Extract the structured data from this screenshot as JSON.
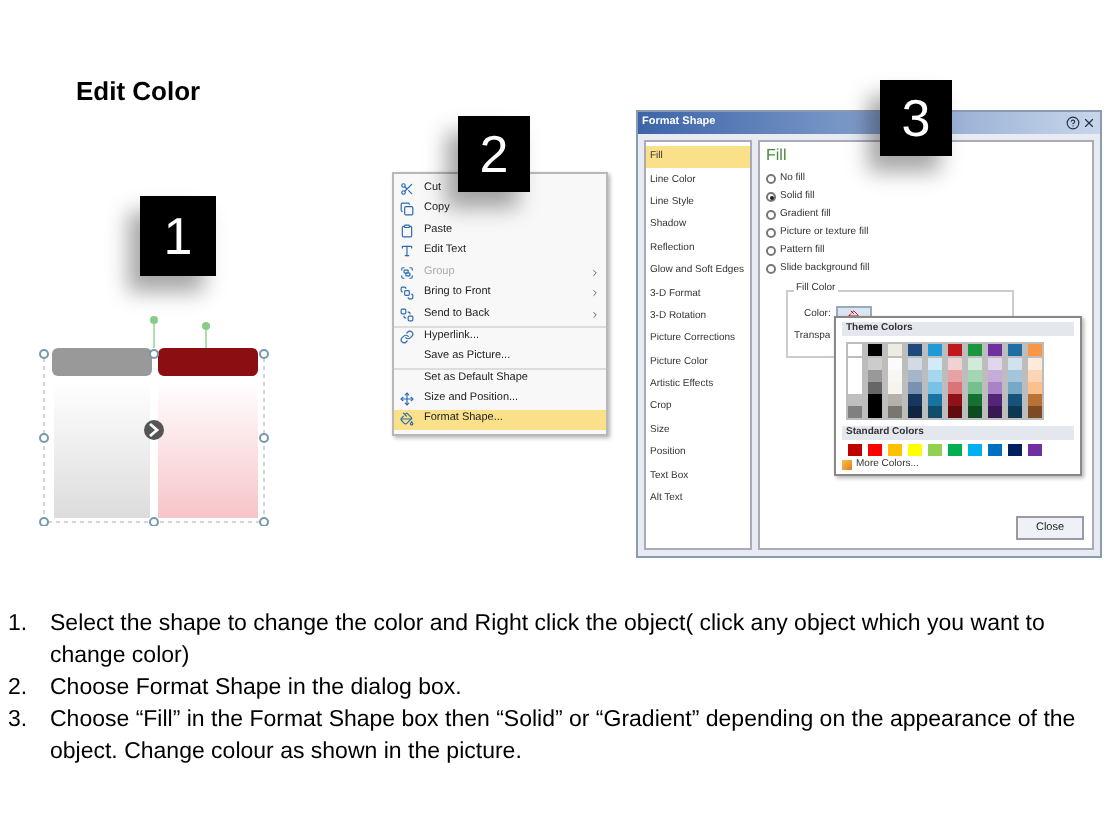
{
  "title": "Edit Color",
  "step_badges": [
    {
      "number": "1"
    },
    {
      "number": "2"
    },
    {
      "number": "3"
    }
  ],
  "context_menu": {
    "items": [
      {
        "label": "Cut",
        "disabled": false,
        "submenu": false,
        "selected": false
      },
      {
        "label": "Copy",
        "disabled": false,
        "submenu": false,
        "selected": false
      },
      {
        "label": "Paste",
        "disabled": false,
        "submenu": false,
        "selected": false
      },
      {
        "label": "Edit Text",
        "disabled": false,
        "submenu": false,
        "selected": false
      },
      {
        "label": "Group",
        "disabled": true,
        "submenu": true,
        "selected": false
      },
      {
        "label": "Bring to Front",
        "disabled": false,
        "submenu": true,
        "selected": false
      },
      {
        "label": "Send to Back",
        "disabled": false,
        "submenu": true,
        "selected": false
      },
      {
        "label": "Hyperlink...",
        "disabled": false,
        "submenu": false,
        "selected": false
      },
      {
        "label": "Save as Picture...",
        "disabled": false,
        "submenu": false,
        "selected": false
      },
      {
        "label": "Set as Default Shape",
        "disabled": false,
        "submenu": false,
        "selected": false
      },
      {
        "label": "Size and Position...",
        "disabled": false,
        "submenu": false,
        "selected": false
      },
      {
        "label": "Format Shape...",
        "disabled": false,
        "submenu": false,
        "selected": true
      }
    ]
  },
  "dialog": {
    "title": "Format Shape",
    "sidebar": [
      {
        "label": "Fill",
        "selected": true
      },
      {
        "label": "Line Color",
        "selected": false
      },
      {
        "label": "Line Style",
        "selected": false
      },
      {
        "label": "Shadow",
        "selected": false
      },
      {
        "label": "Reflection",
        "selected": false
      },
      {
        "label": "Glow and Soft Edges",
        "selected": false
      },
      {
        "label": "3-D Format",
        "selected": false
      },
      {
        "label": "3-D Rotation",
        "selected": false
      },
      {
        "label": "Picture Corrections",
        "selected": false
      },
      {
        "label": "Picture Color",
        "selected": false
      },
      {
        "label": "Artistic Effects",
        "selected": false
      },
      {
        "label": "Crop",
        "selected": false
      },
      {
        "label": "Size",
        "selected": false
      },
      {
        "label": "Position",
        "selected": false
      },
      {
        "label": "Text Box",
        "selected": false
      },
      {
        "label": "Alt Text",
        "selected": false
      }
    ],
    "heading": "Fill",
    "fill_options": [
      {
        "label": "No fill",
        "selected": false
      },
      {
        "label": "Solid fill",
        "selected": true
      },
      {
        "label": "Gradient fill",
        "selected": false
      },
      {
        "label": "Picture or texture fill",
        "selected": false
      },
      {
        "label": "Pattern fill",
        "selected": false
      },
      {
        "label": "Slide background fill",
        "selected": false
      }
    ],
    "fill_color_group": "Fill Color",
    "color_label": "Color:",
    "transparency_label": "Transpa",
    "close_button": "Close"
  },
  "color_popup": {
    "theme_heading": "Theme Colors",
    "theme_colors": [
      {
        "color": "#ffffff"
      },
      {
        "color": "#000000"
      },
      {
        "color": "#eeece1"
      },
      {
        "color": "#1f497d"
      },
      {
        "color": "#1e9ad6"
      },
      {
        "color": "#c0171d"
      },
      {
        "color": "#1a9641"
      },
      {
        "color": "#7030a0"
      },
      {
        "color": "#1c6ea4"
      },
      {
        "color": "#f79646"
      }
    ],
    "standard_heading": "Standard Colors",
    "standard_colors": [
      {
        "color": "#c00000"
      },
      {
        "color": "#ff0000"
      },
      {
        "color": "#ffc000"
      },
      {
        "color": "#ffff00"
      },
      {
        "color": "#92d050"
      },
      {
        "color": "#00b050"
      },
      {
        "color": "#00b0f0"
      },
      {
        "color": "#0070c0"
      },
      {
        "color": "#002060"
      },
      {
        "color": "#7030a0"
      }
    ],
    "more_colors": "More Colors..."
  },
  "instructions": [
    {
      "number": "1.",
      "text": "Select the shape to change the color and Right click the object( click any object which you want to change color)"
    },
    {
      "number": "2.",
      "text": "Choose Format Shape in the dialog box."
    },
    {
      "number": "3.",
      "text": "Choose “Fill” in the Format Shape box then “Solid” or “Gradient” depending on the appearance of the object. Change colour as shown in the picture."
    }
  ]
}
